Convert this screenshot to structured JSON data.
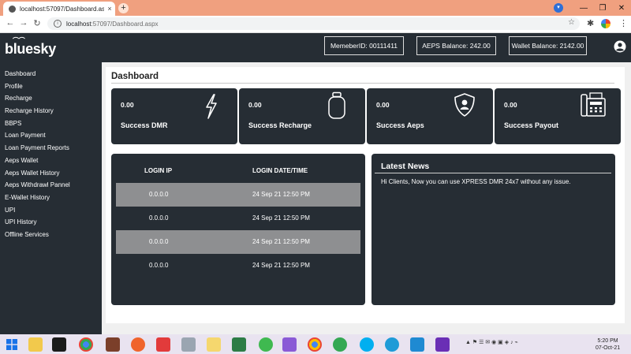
{
  "browser": {
    "tab_title": "localhost:57097/Dashboard.aspx",
    "tab_close": "×",
    "new_tab": "+",
    "url_host": "localhost",
    "url_path": ":57097/Dashboard.aspx",
    "win_min": "—",
    "win_max": "❐",
    "win_close": "✕"
  },
  "header": {
    "logo": "bluesky",
    "member_id": "MemeberID: 00111411",
    "aeps_balance": "AEPS Balance: 242.00",
    "wallet_balance": "Wallet Balance: 2142.00"
  },
  "sidebar": {
    "items": [
      {
        "label": "Dashboard"
      },
      {
        "label": "Profile"
      },
      {
        "label": "Recharge"
      },
      {
        "label": "Recharge History"
      },
      {
        "label": "BBPS"
      },
      {
        "label": "Loan Payment"
      },
      {
        "label": "Loan Payment Reports"
      },
      {
        "label": "Aeps Wallet"
      },
      {
        "label": "Aeps Wallet History"
      },
      {
        "label": "Aeps Withdrawl Pannel"
      },
      {
        "label": "E-Wallet History"
      },
      {
        "label": "UPI"
      },
      {
        "label": "UPI History"
      },
      {
        "label": "Offline Services"
      }
    ]
  },
  "dashboard": {
    "title": "Dashboard",
    "cards": [
      {
        "value": "0.00",
        "label": "Success DMR",
        "icon": "lightning-icon"
      },
      {
        "value": "0.00",
        "label": "Success Recharge",
        "icon": "gas-cylinder-icon"
      },
      {
        "value": "0.00",
        "label": "Success Aeps",
        "icon": "shield-user-icon"
      },
      {
        "value": "0.00",
        "label": "Success Payout",
        "icon": "fax-machine-icon"
      }
    ]
  },
  "login_table": {
    "headers": [
      "LOGIN IP",
      "LOGIN DATE/TIME"
    ],
    "rows": [
      {
        "ip": "0.0.0.0",
        "datetime": "24 Sep 21 12:50 PM"
      },
      {
        "ip": "0.0.0.0",
        "datetime": "24 Sep 21 12:50 PM"
      },
      {
        "ip": "0.0.0.0",
        "datetime": "24 Sep 21 12:50 PM"
      },
      {
        "ip": "0.0.0.0",
        "datetime": "24 Sep 21 12:50 PM"
      }
    ]
  },
  "news": {
    "title": "Latest News",
    "text": "Hi Clients, Now you can use XPRESS DMR 24x7 without any issue."
  },
  "taskbar": {
    "time": "5:20 PM",
    "date": "07-Oct-21"
  },
  "colors": {
    "panel": "#262d34",
    "row_shade": "#8e8f91",
    "tabstrip": "#f0a07f"
  }
}
